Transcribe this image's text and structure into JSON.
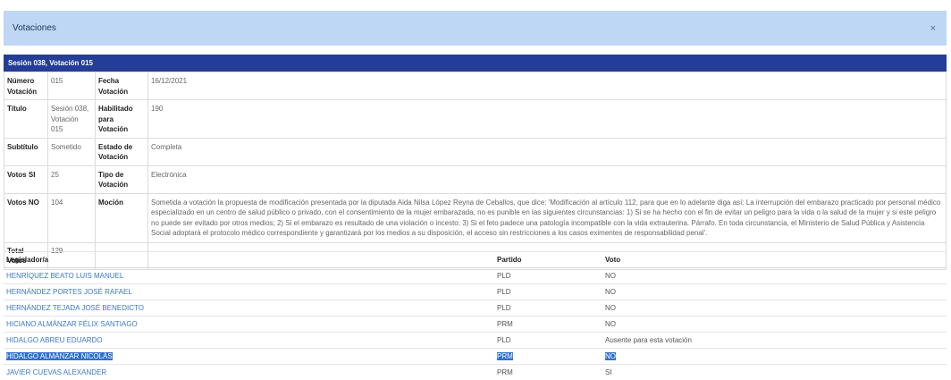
{
  "modal": {
    "title": "Votaciones",
    "close_symbol": "×"
  },
  "session_header": "Sesión 038, Votación 015",
  "details": {
    "numero_label": "Número Votación",
    "numero_value": "015",
    "fecha_label": "Fecha Votación",
    "fecha_value": "16/12/2021",
    "titulo_label": "Título",
    "titulo_value": "Sesión 038, Votación 015",
    "habilitado_label": "Habilitado para Votación",
    "habilitado_value": "190",
    "subtitulo_label": "Subtítulo",
    "subtitulo_value": "Sometido",
    "estado_label": "Estado de Votación",
    "estado_value": "Completa",
    "votos_si_label": "Votos SI",
    "votos_si_value": "25",
    "tipo_label": "Tipo de Votación",
    "tipo_value": "Electrónica",
    "votos_no_label": "Votos NO",
    "votos_no_value": "104",
    "mocion_label": "Moción",
    "mocion_value": "Sometida a votación la propuesta de modificación presentada por la diputada Aida Nilsa López Reyna de Ceballos, que dice: 'Modificación al artículo 112, para que en lo adelante diga así: La interrupción del embarazo practicado por personal médico especializado en un centro de salud público o privado, con el consentimiento de la mujer embarazada, no es punible en las siguientes circunstancias: 1) Si se ha hecho con el fin de evitar un peligro para la vida o la salud de la mujer y si este peligro no puede ser evitado por otros medios; 2) Si el embarazo es resultado de una violación o incesto; 3) Si el feto padece una patología incompatible con la vida extrauterina. Párrafo. En toda circunstancia, el Ministerio de Salud Pública y Asistencia Social adoptará el protocolo médico correspondiente y garantizará por los medios a su disposición, el acceso sin restricciones a los casos eximentes de responsabilidad penal'.",
    "total_label": "Total Votos",
    "total_value": "129"
  },
  "votes_table": {
    "headers": {
      "legislador": "Legislador/a",
      "partido": "Partido",
      "voto": "Voto"
    },
    "rows": [
      {
        "name": "HENRÍQUEZ BEATO LUIS MANUEL",
        "party": "PLD",
        "vote": "NO"
      },
      {
        "name": "HERNÁNDEZ PORTES JOSÉ RAFAEL",
        "party": "PLD",
        "vote": "NO"
      },
      {
        "name": "HERNÁNDEZ TEJADA JOSÉ BENEDICTO",
        "party": "PLD",
        "vote": "NO"
      },
      {
        "name": "HICIANO ALMÁNZAR FÉLIX SANTIAGO",
        "party": "PRM",
        "vote": "NO"
      },
      {
        "name": "HIDALGO ABREU EDUARDO",
        "party": "PLD",
        "vote": "Ausente para esta votación"
      },
      {
        "name": "HIDALGO ALMÁNZAR NICOLÁS",
        "party": "PRM",
        "vote": "NO"
      },
      {
        "name": "JAVIER CUEVAS ALEXANDER",
        "party": "PRM",
        "vote": "SI"
      }
    ]
  },
  "colors": {
    "header_bg": "#bed7f5",
    "session_bar": "#243d96",
    "link": "#3a78c8",
    "selection": "#2f6fd1"
  }
}
